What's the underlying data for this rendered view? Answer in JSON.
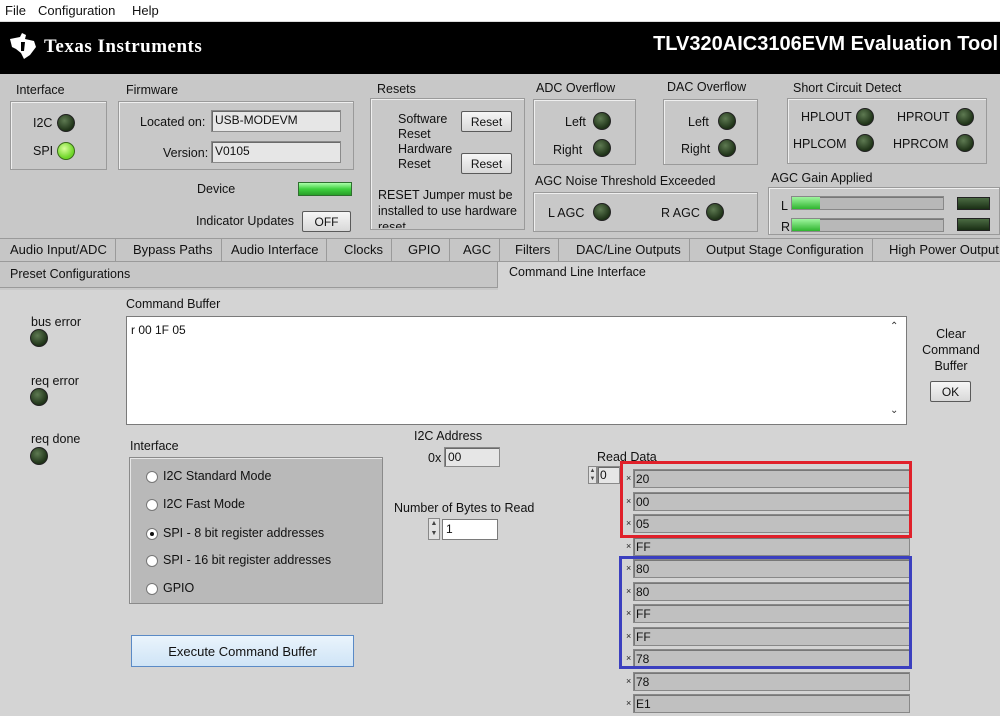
{
  "menu": [
    "File",
    "Configuration",
    "Help"
  ],
  "banner": {
    "company": "Texas Instruments",
    "app_title": "TLV320AIC3106EVM Evaluation Tool"
  },
  "interface_panel": {
    "title": "Interface",
    "i2c": "I2C",
    "spi": "SPI"
  },
  "firmware": {
    "title": "Firmware",
    "located_label": "Located on:",
    "located_value": "USB-MODEVM",
    "version_label": "Version:",
    "version_value": "V0105"
  },
  "device": {
    "label": "Device",
    "indicator_label": "Indicator Updates",
    "indicator_button": "OFF"
  },
  "resets": {
    "title": "Resets",
    "software_label": "Software\nReset",
    "hardware_label": "Hardware\nReset",
    "button": "Reset",
    "note": "RESET Jumper must be installed to use hardware reset"
  },
  "adc_overflow": {
    "title": "ADC Overflow",
    "left": "Left",
    "right": "Right"
  },
  "dac_overflow": {
    "title": "DAC Overflow",
    "left": "Left",
    "right": "Right"
  },
  "short_circuit": {
    "title": "Short Circuit Detect",
    "hplout": "HPLOUT",
    "hprout": "HPROUT",
    "hplcom": "HPLCOM",
    "hprcom": "HPRCOM"
  },
  "agc_noise": {
    "title": "AGC Noise Threshold Exceeded",
    "lagc": "L AGC",
    "ragc": "R AGC"
  },
  "agc_gain": {
    "title": "AGC Gain Applied",
    "l": "L",
    "r": "R"
  },
  "tabs": [
    "Audio Input/ADC",
    "Bypass Paths",
    "Audio Interface",
    "Clocks",
    "GPIO",
    "AGC",
    "Filters",
    "DAC/Line Outputs",
    "Output Stage Configuration",
    "High Power Output"
  ],
  "tabs_row2": {
    "preset": "Preset Configurations",
    "cli": "Command Line Interface"
  },
  "status": {
    "bus_error": "bus error",
    "req_error": "req error",
    "req_done": "req done"
  },
  "command_buffer": {
    "title": "Command Buffer",
    "value": "r 00 1F 05"
  },
  "clear": {
    "label": "Clear\nCommand\nBuffer",
    "button": "OK"
  },
  "cli_interface": {
    "title": "Interface",
    "options": [
      "I2C Standard Mode",
      "I2C Fast Mode",
      "SPI - 8 bit register addresses",
      "SPI - 16 bit register addresses",
      "GPIO"
    ],
    "selected": 2
  },
  "i2c_address": {
    "title": "I2C Address",
    "prefix": "0x",
    "value": "00"
  },
  "bytes_to_read": {
    "title": "Number of Bytes to Read",
    "value": "1"
  },
  "read_data": {
    "title": "Read Data",
    "index": "0",
    "values": [
      "20",
      "00",
      "05",
      "FF",
      "80",
      "80",
      "FF",
      "FF",
      "78",
      "78",
      "E1"
    ]
  },
  "execute_button": "Execute Command Buffer",
  "colors": {
    "red_highlight": "#e0202a",
    "blue_highlight": "#3b3fbf",
    "led_on": "#6fd629",
    "meter_green": "#37c837"
  }
}
